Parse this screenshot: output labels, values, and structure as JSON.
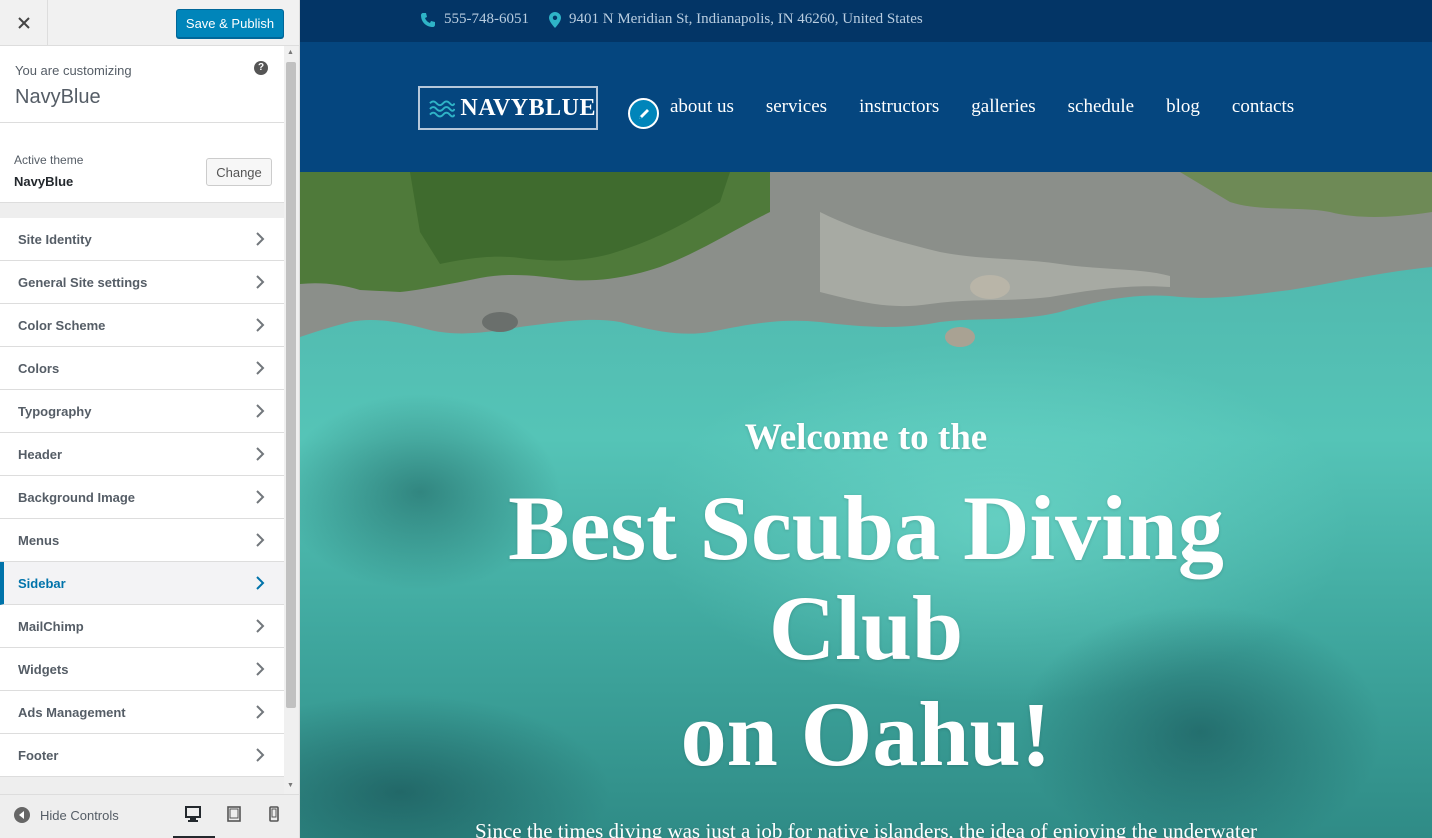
{
  "customizer": {
    "close_icon": "close-icon",
    "publish_label": "Save & Publish",
    "info": {
      "small": "You are customizing",
      "site": "NavyBlue"
    },
    "theme": {
      "label": "Active theme",
      "name": "NavyBlue",
      "change_label": "Change"
    },
    "sections": [
      {
        "label": "Site Identity"
      },
      {
        "label": "General Site settings"
      },
      {
        "label": "Color Scheme"
      },
      {
        "label": "Colors"
      },
      {
        "label": "Typography"
      },
      {
        "label": "Header"
      },
      {
        "label": "Background Image"
      },
      {
        "label": "Menus"
      },
      {
        "label": "Sidebar",
        "active": true
      },
      {
        "label": "MailChimp"
      },
      {
        "label": "Widgets"
      },
      {
        "label": "Ads Management"
      },
      {
        "label": "Footer"
      }
    ],
    "hide_controls_label": "Hide Controls",
    "devices": [
      "desktop",
      "tablet",
      "mobile"
    ],
    "colors": {
      "accent": "#0073aa",
      "publish": "#0085ba"
    }
  },
  "site": {
    "topbar": {
      "phone": "555-748-6051",
      "address": "9401 N Meridian St, Indianapolis, IN 46260, United States"
    },
    "logo_text": "NAVYBLUE",
    "menu": [
      "about us",
      "services",
      "instructors",
      "galleries",
      "schedule",
      "blog",
      "contacts"
    ],
    "hero": {
      "welcome": "Welcome to the",
      "line1": "Best Scuba Diving",
      "line2": "Club",
      "line3": "on Oahu!",
      "sub": "Since the times diving was just a job for native islanders, the idea of enjoying the underwater"
    },
    "colors": {
      "topbar": "#033566",
      "navbar": "#05467f",
      "water": "#55c4b7"
    }
  }
}
